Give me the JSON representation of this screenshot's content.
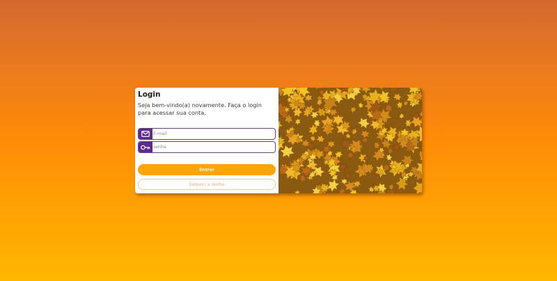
{
  "login": {
    "title": "Login",
    "subtitle": "Seja bem-vindo(a) novamente. Faça o login para acessar sua conta.",
    "email_placeholder": "E-mail",
    "email_value": "",
    "email_icon": "envelope-icon",
    "password_placeholder": "senha",
    "password_value": "",
    "password_icon": "key-icon",
    "submit_label": "Entrar",
    "forgot_label": "Esqueci a senha"
  },
  "colors": {
    "background_top": "#d2692f",
    "background_bottom": "#ffb700",
    "accent_purple": "#5d2a92",
    "primary_orange": "#ffa500",
    "secondary_text": "#f4a87a"
  },
  "image": {
    "subject": "autumn-leaves-photo"
  }
}
